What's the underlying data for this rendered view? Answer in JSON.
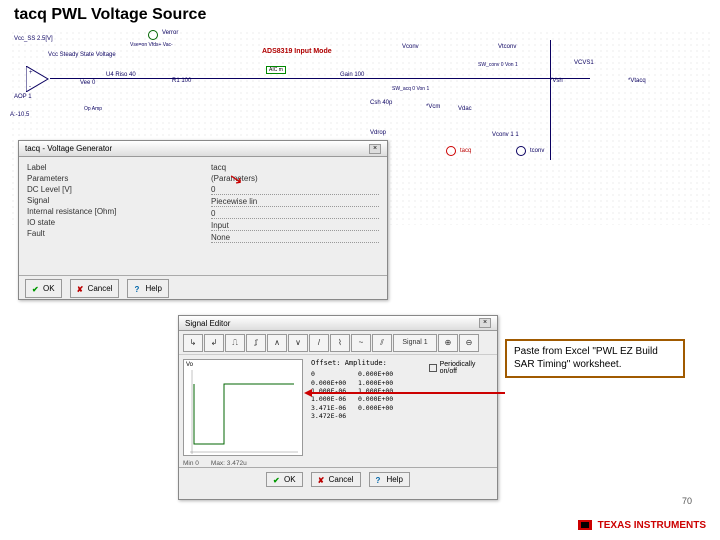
{
  "title": "tacq PWL Voltage Source",
  "page_number": "70",
  "ti_brand": "TEXAS INSTRUMENTS",
  "schematic": {
    "vcc_ss": "Vcc_SS 2.5[V]",
    "steady": "Vcc Steady State Voltage",
    "ads_mode": "ADS8319 Input Mode",
    "aop1": "AOP 1",
    "verror": "Verror",
    "verror_mode": "Vse=on   Vfds+   Vac-",
    "vee": "Vee\n0",
    "u4": "U4    Riso 40",
    "r1": "R1 100",
    "vref_cm": "A:-10.5",
    "aic_m": "AIC m",
    "gain": "Gain 100",
    "sw_conv": "SW_conv 0\nVon 1",
    "sw_acq": "SW_acq 0\nVon 1",
    "csh": "Csh 40p",
    "vcm": "*Vcm",
    "vdrop": "Vdrop",
    "vdac": "Vdac",
    "vsh": "*Vsh",
    "vcvs1": "VCVS1",
    "vtacq": "*Vtacq",
    "vconv_1_1": "Vconv 1 1",
    "vtacq2": "tacq",
    "vconv2": "tconv"
  },
  "dialog1": {
    "title": "tacq - Voltage Generator",
    "rows_left": [
      {
        "label": "Label",
        "value": "tacq"
      },
      {
        "label": "Parameters",
        "value": ""
      },
      {
        "label": "DC Level [V]",
        "value": "0"
      },
      {
        "label": "Signal",
        "value": ""
      },
      {
        "label": "Internal resistance [Ohm]",
        "value": "0"
      },
      {
        "label": "IO state",
        "value": "Input"
      },
      {
        "label": "Fault",
        "value": "None"
      }
    ],
    "rows_right": [
      {
        "label": "",
        "value": "(Parameters)"
      },
      {
        "label": "",
        "value": ""
      },
      {
        "label": "",
        "value": "0"
      },
      {
        "label": "",
        "value": "Piecewise lin"
      },
      {
        "label": "",
        "value": "0"
      },
      {
        "label": "",
        "value": "Input"
      },
      {
        "label": "",
        "value": "None"
      }
    ],
    "buttons": {
      "ok": "OK",
      "cancel": "Cancel",
      "help": "Help"
    }
  },
  "dialog2": {
    "title": "Signal Editor",
    "toolbar_icons": [
      "↳",
      "↲",
      "⎍",
      "⎎",
      "∧",
      "∨",
      "/",
      "⌇",
      "~",
      "⫽",
      "Signal 1",
      "⊕",
      "⊖"
    ],
    "plot_label": "Vo",
    "data_title": "Offset:  Amplitude:",
    "data_rows": [
      "0           0.000E+00",
      "0.000E+00   1.000E+00",
      "1.000E-06   1.000E+00",
      "1.000E-06   0.000E+00",
      "3.471E-06   0.000E+00",
      "3.472E-06"
    ],
    "checkbox": "Periodically on/off",
    "status": {
      "min": "Min 0",
      "max": "Max: 3.472u"
    },
    "buttons": {
      "ok": "OK",
      "cancel": "Cancel",
      "help": "Help"
    }
  },
  "callout": "Paste from Excel \"PWL EZ Build SAR Timing\" worksheet."
}
